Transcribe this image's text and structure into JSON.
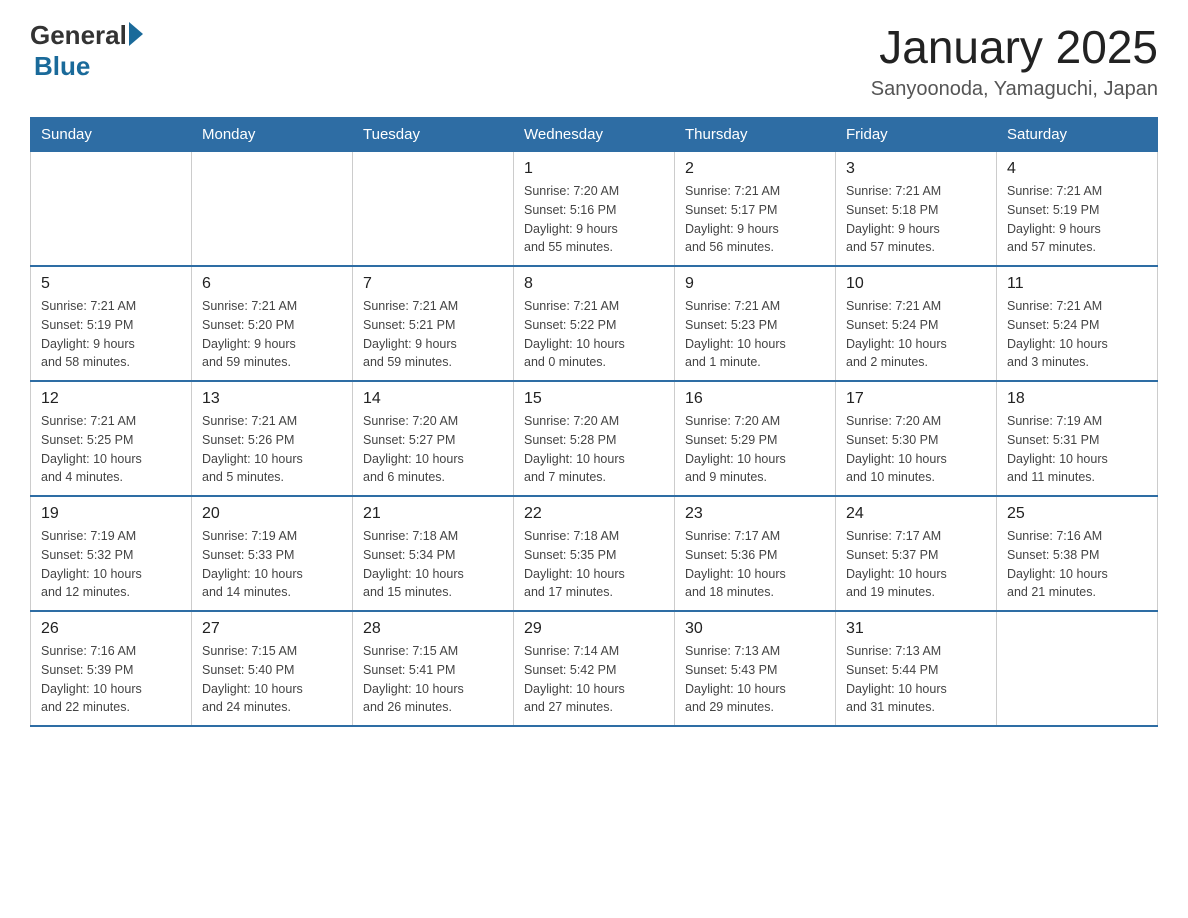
{
  "header": {
    "logo_general": "General",
    "logo_blue": "Blue",
    "month_title": "January 2025",
    "location": "Sanyoonoda, Yamaguchi, Japan"
  },
  "days_of_week": [
    "Sunday",
    "Monday",
    "Tuesday",
    "Wednesday",
    "Thursday",
    "Friday",
    "Saturday"
  ],
  "weeks": [
    [
      {
        "day": "",
        "info": ""
      },
      {
        "day": "",
        "info": ""
      },
      {
        "day": "",
        "info": ""
      },
      {
        "day": "1",
        "info": "Sunrise: 7:20 AM\nSunset: 5:16 PM\nDaylight: 9 hours\nand 55 minutes."
      },
      {
        "day": "2",
        "info": "Sunrise: 7:21 AM\nSunset: 5:17 PM\nDaylight: 9 hours\nand 56 minutes."
      },
      {
        "day": "3",
        "info": "Sunrise: 7:21 AM\nSunset: 5:18 PM\nDaylight: 9 hours\nand 57 minutes."
      },
      {
        "day": "4",
        "info": "Sunrise: 7:21 AM\nSunset: 5:19 PM\nDaylight: 9 hours\nand 57 minutes."
      }
    ],
    [
      {
        "day": "5",
        "info": "Sunrise: 7:21 AM\nSunset: 5:19 PM\nDaylight: 9 hours\nand 58 minutes."
      },
      {
        "day": "6",
        "info": "Sunrise: 7:21 AM\nSunset: 5:20 PM\nDaylight: 9 hours\nand 59 minutes."
      },
      {
        "day": "7",
        "info": "Sunrise: 7:21 AM\nSunset: 5:21 PM\nDaylight: 9 hours\nand 59 minutes."
      },
      {
        "day": "8",
        "info": "Sunrise: 7:21 AM\nSunset: 5:22 PM\nDaylight: 10 hours\nand 0 minutes."
      },
      {
        "day": "9",
        "info": "Sunrise: 7:21 AM\nSunset: 5:23 PM\nDaylight: 10 hours\nand 1 minute."
      },
      {
        "day": "10",
        "info": "Sunrise: 7:21 AM\nSunset: 5:24 PM\nDaylight: 10 hours\nand 2 minutes."
      },
      {
        "day": "11",
        "info": "Sunrise: 7:21 AM\nSunset: 5:24 PM\nDaylight: 10 hours\nand 3 minutes."
      }
    ],
    [
      {
        "day": "12",
        "info": "Sunrise: 7:21 AM\nSunset: 5:25 PM\nDaylight: 10 hours\nand 4 minutes."
      },
      {
        "day": "13",
        "info": "Sunrise: 7:21 AM\nSunset: 5:26 PM\nDaylight: 10 hours\nand 5 minutes."
      },
      {
        "day": "14",
        "info": "Sunrise: 7:20 AM\nSunset: 5:27 PM\nDaylight: 10 hours\nand 6 minutes."
      },
      {
        "day": "15",
        "info": "Sunrise: 7:20 AM\nSunset: 5:28 PM\nDaylight: 10 hours\nand 7 minutes."
      },
      {
        "day": "16",
        "info": "Sunrise: 7:20 AM\nSunset: 5:29 PM\nDaylight: 10 hours\nand 9 minutes."
      },
      {
        "day": "17",
        "info": "Sunrise: 7:20 AM\nSunset: 5:30 PM\nDaylight: 10 hours\nand 10 minutes."
      },
      {
        "day": "18",
        "info": "Sunrise: 7:19 AM\nSunset: 5:31 PM\nDaylight: 10 hours\nand 11 minutes."
      }
    ],
    [
      {
        "day": "19",
        "info": "Sunrise: 7:19 AM\nSunset: 5:32 PM\nDaylight: 10 hours\nand 12 minutes."
      },
      {
        "day": "20",
        "info": "Sunrise: 7:19 AM\nSunset: 5:33 PM\nDaylight: 10 hours\nand 14 minutes."
      },
      {
        "day": "21",
        "info": "Sunrise: 7:18 AM\nSunset: 5:34 PM\nDaylight: 10 hours\nand 15 minutes."
      },
      {
        "day": "22",
        "info": "Sunrise: 7:18 AM\nSunset: 5:35 PM\nDaylight: 10 hours\nand 17 minutes."
      },
      {
        "day": "23",
        "info": "Sunrise: 7:17 AM\nSunset: 5:36 PM\nDaylight: 10 hours\nand 18 minutes."
      },
      {
        "day": "24",
        "info": "Sunrise: 7:17 AM\nSunset: 5:37 PM\nDaylight: 10 hours\nand 19 minutes."
      },
      {
        "day": "25",
        "info": "Sunrise: 7:16 AM\nSunset: 5:38 PM\nDaylight: 10 hours\nand 21 minutes."
      }
    ],
    [
      {
        "day": "26",
        "info": "Sunrise: 7:16 AM\nSunset: 5:39 PM\nDaylight: 10 hours\nand 22 minutes."
      },
      {
        "day": "27",
        "info": "Sunrise: 7:15 AM\nSunset: 5:40 PM\nDaylight: 10 hours\nand 24 minutes."
      },
      {
        "day": "28",
        "info": "Sunrise: 7:15 AM\nSunset: 5:41 PM\nDaylight: 10 hours\nand 26 minutes."
      },
      {
        "day": "29",
        "info": "Sunrise: 7:14 AM\nSunset: 5:42 PM\nDaylight: 10 hours\nand 27 minutes."
      },
      {
        "day": "30",
        "info": "Sunrise: 7:13 AM\nSunset: 5:43 PM\nDaylight: 10 hours\nand 29 minutes."
      },
      {
        "day": "31",
        "info": "Sunrise: 7:13 AM\nSunset: 5:44 PM\nDaylight: 10 hours\nand 31 minutes."
      },
      {
        "day": "",
        "info": ""
      }
    ]
  ]
}
